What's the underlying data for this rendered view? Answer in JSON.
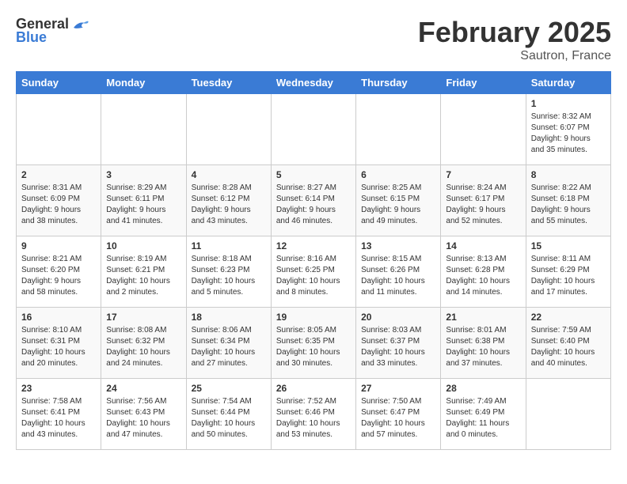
{
  "header": {
    "logo": {
      "general": "General",
      "blue": "Blue"
    },
    "title": "February 2025",
    "location": "Sautron, France"
  },
  "weekdays": [
    "Sunday",
    "Monday",
    "Tuesday",
    "Wednesday",
    "Thursday",
    "Friday",
    "Saturday"
  ],
  "weeks": [
    [
      null,
      null,
      null,
      null,
      null,
      null,
      {
        "day": "1",
        "sunrise": "Sunrise: 8:32 AM",
        "sunset": "Sunset: 6:07 PM",
        "daylight": "Daylight: 9 hours and 35 minutes."
      }
    ],
    [
      {
        "day": "2",
        "sunrise": "Sunrise: 8:31 AM",
        "sunset": "Sunset: 6:09 PM",
        "daylight": "Daylight: 9 hours and 38 minutes."
      },
      {
        "day": "3",
        "sunrise": "Sunrise: 8:29 AM",
        "sunset": "Sunset: 6:11 PM",
        "daylight": "Daylight: 9 hours and 41 minutes."
      },
      {
        "day": "4",
        "sunrise": "Sunrise: 8:28 AM",
        "sunset": "Sunset: 6:12 PM",
        "daylight": "Daylight: 9 hours and 43 minutes."
      },
      {
        "day": "5",
        "sunrise": "Sunrise: 8:27 AM",
        "sunset": "Sunset: 6:14 PM",
        "daylight": "Daylight: 9 hours and 46 minutes."
      },
      {
        "day": "6",
        "sunrise": "Sunrise: 8:25 AM",
        "sunset": "Sunset: 6:15 PM",
        "daylight": "Daylight: 9 hours and 49 minutes."
      },
      {
        "day": "7",
        "sunrise": "Sunrise: 8:24 AM",
        "sunset": "Sunset: 6:17 PM",
        "daylight": "Daylight: 9 hours and 52 minutes."
      },
      {
        "day": "8",
        "sunrise": "Sunrise: 8:22 AM",
        "sunset": "Sunset: 6:18 PM",
        "daylight": "Daylight: 9 hours and 55 minutes."
      }
    ],
    [
      {
        "day": "9",
        "sunrise": "Sunrise: 8:21 AM",
        "sunset": "Sunset: 6:20 PM",
        "daylight": "Daylight: 9 hours and 58 minutes."
      },
      {
        "day": "10",
        "sunrise": "Sunrise: 8:19 AM",
        "sunset": "Sunset: 6:21 PM",
        "daylight": "Daylight: 10 hours and 2 minutes."
      },
      {
        "day": "11",
        "sunrise": "Sunrise: 8:18 AM",
        "sunset": "Sunset: 6:23 PM",
        "daylight": "Daylight: 10 hours and 5 minutes."
      },
      {
        "day": "12",
        "sunrise": "Sunrise: 8:16 AM",
        "sunset": "Sunset: 6:25 PM",
        "daylight": "Daylight: 10 hours and 8 minutes."
      },
      {
        "day": "13",
        "sunrise": "Sunrise: 8:15 AM",
        "sunset": "Sunset: 6:26 PM",
        "daylight": "Daylight: 10 hours and 11 minutes."
      },
      {
        "day": "14",
        "sunrise": "Sunrise: 8:13 AM",
        "sunset": "Sunset: 6:28 PM",
        "daylight": "Daylight: 10 hours and 14 minutes."
      },
      {
        "day": "15",
        "sunrise": "Sunrise: 8:11 AM",
        "sunset": "Sunset: 6:29 PM",
        "daylight": "Daylight: 10 hours and 17 minutes."
      }
    ],
    [
      {
        "day": "16",
        "sunrise": "Sunrise: 8:10 AM",
        "sunset": "Sunset: 6:31 PM",
        "daylight": "Daylight: 10 hours and 20 minutes."
      },
      {
        "day": "17",
        "sunrise": "Sunrise: 8:08 AM",
        "sunset": "Sunset: 6:32 PM",
        "daylight": "Daylight: 10 hours and 24 minutes."
      },
      {
        "day": "18",
        "sunrise": "Sunrise: 8:06 AM",
        "sunset": "Sunset: 6:34 PM",
        "daylight": "Daylight: 10 hours and 27 minutes."
      },
      {
        "day": "19",
        "sunrise": "Sunrise: 8:05 AM",
        "sunset": "Sunset: 6:35 PM",
        "daylight": "Daylight: 10 hours and 30 minutes."
      },
      {
        "day": "20",
        "sunrise": "Sunrise: 8:03 AM",
        "sunset": "Sunset: 6:37 PM",
        "daylight": "Daylight: 10 hours and 33 minutes."
      },
      {
        "day": "21",
        "sunrise": "Sunrise: 8:01 AM",
        "sunset": "Sunset: 6:38 PM",
        "daylight": "Daylight: 10 hours and 37 minutes."
      },
      {
        "day": "22",
        "sunrise": "Sunrise: 7:59 AM",
        "sunset": "Sunset: 6:40 PM",
        "daylight": "Daylight: 10 hours and 40 minutes."
      }
    ],
    [
      {
        "day": "23",
        "sunrise": "Sunrise: 7:58 AM",
        "sunset": "Sunset: 6:41 PM",
        "daylight": "Daylight: 10 hours and 43 minutes."
      },
      {
        "day": "24",
        "sunrise": "Sunrise: 7:56 AM",
        "sunset": "Sunset: 6:43 PM",
        "daylight": "Daylight: 10 hours and 47 minutes."
      },
      {
        "day": "25",
        "sunrise": "Sunrise: 7:54 AM",
        "sunset": "Sunset: 6:44 PM",
        "daylight": "Daylight: 10 hours and 50 minutes."
      },
      {
        "day": "26",
        "sunrise": "Sunrise: 7:52 AM",
        "sunset": "Sunset: 6:46 PM",
        "daylight": "Daylight: 10 hours and 53 minutes."
      },
      {
        "day": "27",
        "sunrise": "Sunrise: 7:50 AM",
        "sunset": "Sunset: 6:47 PM",
        "daylight": "Daylight: 10 hours and 57 minutes."
      },
      {
        "day": "28",
        "sunrise": "Sunrise: 7:49 AM",
        "sunset": "Sunset: 6:49 PM",
        "daylight": "Daylight: 11 hours and 0 minutes."
      },
      null
    ]
  ]
}
